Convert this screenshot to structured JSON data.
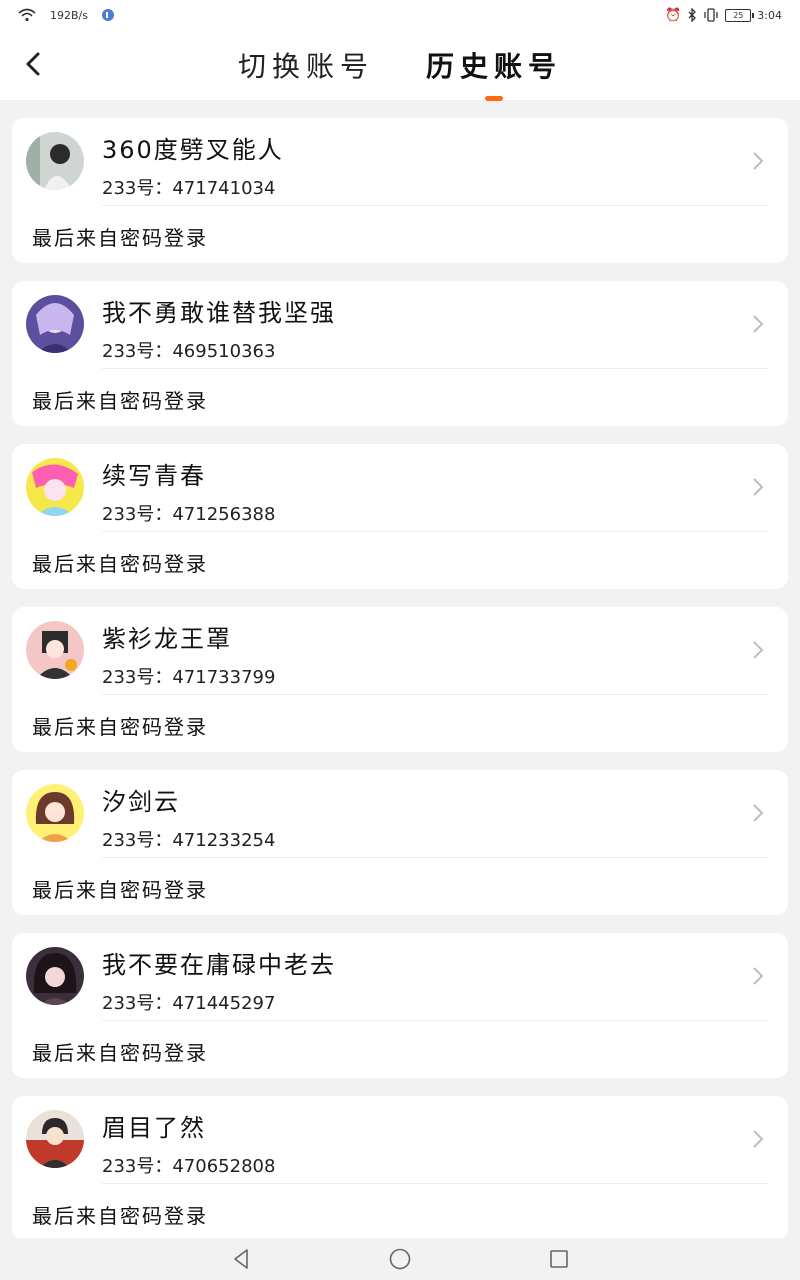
{
  "status_bar": {
    "net_speed": "192B/s",
    "time": "3:04",
    "battery": "25",
    "icons": [
      "wifi-icon",
      "music-icon",
      "alarm-icon",
      "bluetooth-icon",
      "vibrate-icon",
      "battery-icon"
    ]
  },
  "header": {
    "back_icon": "back-arrow-icon",
    "tabs": [
      {
        "label": "切换账号",
        "active": false
      },
      {
        "label": "历史账号",
        "active": true
      }
    ],
    "accent_color": "#ff6a13"
  },
  "accounts": [
    {
      "name": "360度劈叉能人",
      "uid": "233号：471741034",
      "note": "最后来自密码登录"
    },
    {
      "name": "我不勇敢谁替我坚强",
      "uid": "233号：469510363",
      "note": "最后来自密码登录"
    },
    {
      "name": "续写青春",
      "uid": "233号：471256388",
      "note": "最后来自密码登录"
    },
    {
      "name": "紫衫龙王罩",
      "uid": "233号：471733799",
      "note": "最后来自密码登录"
    },
    {
      "name": "汐剑云",
      "uid": "233号：471233254",
      "note": "最后来自密码登录"
    },
    {
      "name": "我不要在庸碌中老去",
      "uid": "233号：471445297",
      "note": "最后来自密码登录"
    },
    {
      "name": "眉目了然",
      "uid": "233号：470652808",
      "note": "最后来自密码登录"
    }
  ],
  "nav_bar": {
    "icons": [
      "back-triangle-icon",
      "home-circle-icon",
      "recents-square-icon"
    ]
  }
}
